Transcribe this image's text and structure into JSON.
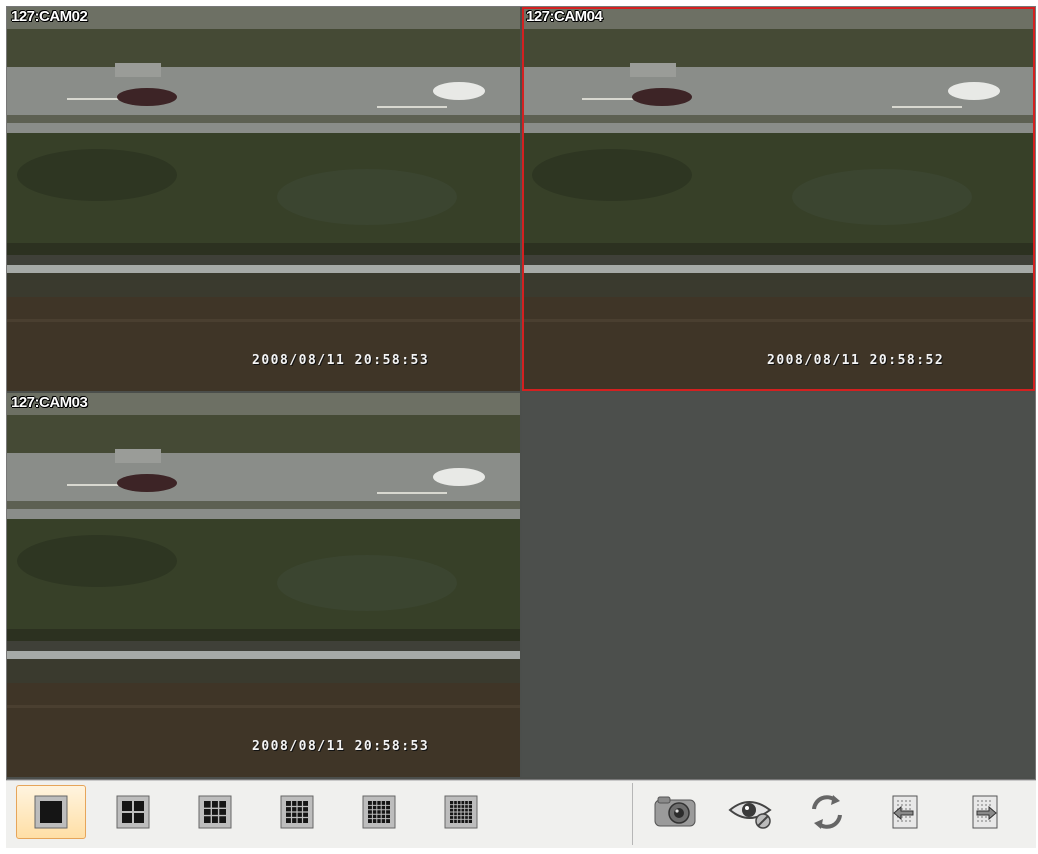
{
  "cameras": [
    {
      "label": "127:CAM02",
      "timestamp": "2008/08/11 20:58:53"
    },
    {
      "label": "127:CAM04",
      "timestamp": "2008/08/11 20:58:52",
      "selected": true
    },
    {
      "label": "127:CAM03",
      "timestamp": "2008/08/11 20:58:53"
    }
  ],
  "toolbar": {
    "layout_buttons": [
      {
        "name": "layout-1x1-icon",
        "grid": 1,
        "active": true
      },
      {
        "name": "layout-2x2-icon",
        "grid": 2
      },
      {
        "name": "layout-3x3-icon",
        "grid": 3
      },
      {
        "name": "layout-4x4-icon",
        "grid": 4
      },
      {
        "name": "layout-5x5-icon",
        "grid": 5
      },
      {
        "name": "layout-6x6-icon",
        "grid": 6
      }
    ],
    "action_buttons": [
      {
        "name": "snapshot-camera-icon"
      },
      {
        "name": "hide-view-eye-icon"
      },
      {
        "name": "refresh-cycle-icon"
      },
      {
        "name": "previous-page-icon"
      },
      {
        "name": "next-page-icon"
      }
    ]
  },
  "colors": {
    "selected_border": "#d42020",
    "active_button": "#ffdfa6",
    "empty_tile": "#4c4f4c"
  }
}
